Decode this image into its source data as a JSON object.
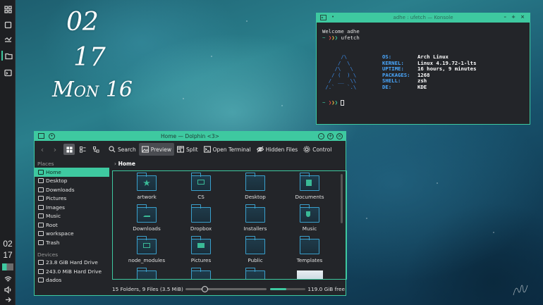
{
  "desktop_clock": {
    "hour": "02",
    "minute": "17",
    "date": "Mon 16"
  },
  "panel": {
    "clock_hour": "02",
    "clock_minute": "17"
  },
  "konsole": {
    "title": "adhe : ufetch — Konsole",
    "welcome": "Welcome adhe",
    "prompt_symbol": "~",
    "command": "ufetch",
    "info": [
      {
        "key": "OS:",
        "value": "Arch Linux"
      },
      {
        "key": "KERNEL:",
        "value": "Linux 4.19.72-1-lts"
      },
      {
        "key": "UPTIME:",
        "value": "16 hours, 9 minutes"
      },
      {
        "key": "PACKAGES:",
        "value": "1268"
      },
      {
        "key": "SHELL:",
        "value": "zsh"
      },
      {
        "key": "DE:",
        "value": "KDE"
      }
    ]
  },
  "dolphin": {
    "title": "Home — Dolphin <3>",
    "toolbar": {
      "search": "Search",
      "preview": "Preview",
      "split": "Split",
      "terminal": "Open Terminal",
      "hidden": "Hidden Files",
      "control": "Control"
    },
    "places_header": "Places",
    "places": [
      "Home",
      "Desktop",
      "Downloads",
      "Pictures",
      "Images",
      "Music",
      "Root",
      "workspace",
      "Trash"
    ],
    "devices_header": "Devices",
    "devices": [
      "23.8 GiB Hard Drive",
      "243.0 MiB Hard Drive",
      "dados"
    ],
    "breadcrumb": "Home",
    "files": [
      "artwork",
      "CS",
      "Desktop",
      "Documents",
      "Downloads",
      "Dropbox",
      "Installers",
      "Music",
      "node_modules",
      "Pictures",
      "Public",
      "Templates"
    ],
    "status_text": "15 Folders, 9 Files (3.5 MiB)",
    "free_space": "119.0 GiB free",
    "accent": "#3ec9a0"
  }
}
